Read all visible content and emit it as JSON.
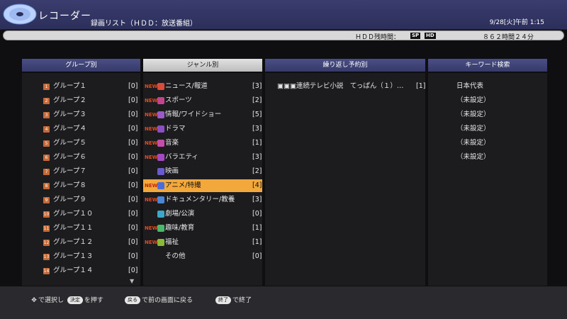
{
  "header": {
    "app_title": "レコーダー",
    "list_title": "録画リスト（ＨＤＤ：放送番組）",
    "datetime": "9/28[火]午前 1:15"
  },
  "hdd": {
    "label": "ＨＤＤ残時間：",
    "badge_sp": "SP",
    "badge_hd": "HD",
    "remaining": "８６２時間２４分"
  },
  "columns": {
    "group": "グループ別",
    "genre": "ジャンル別",
    "repeat": "繰り返し予約別",
    "keyword": "キーワード検索"
  },
  "groups": [
    {
      "badge": "1",
      "name": "グループ１",
      "count": "[0]"
    },
    {
      "badge": "2",
      "name": "グループ２",
      "count": "[0]"
    },
    {
      "badge": "3",
      "name": "グループ３",
      "count": "[0]"
    },
    {
      "badge": "4",
      "name": "グループ４",
      "count": "[0]"
    },
    {
      "badge": "5",
      "name": "グループ５",
      "count": "[0]"
    },
    {
      "badge": "6",
      "name": "グループ６",
      "count": "[0]"
    },
    {
      "badge": "7",
      "name": "グループ７",
      "count": "[0]"
    },
    {
      "badge": "8",
      "name": "グループ８",
      "count": "[0]"
    },
    {
      "badge": "9",
      "name": "グループ９",
      "count": "[0]"
    },
    {
      "badge": "10",
      "name": "グループ１０",
      "count": "[0]"
    },
    {
      "badge": "11",
      "name": "グループ１１",
      "count": "[0]"
    },
    {
      "badge": "12",
      "name": "グループ１２",
      "count": "[0]"
    },
    {
      "badge": "13",
      "name": "グループ１３",
      "count": "[0]"
    },
    {
      "badge": "14",
      "name": "グループ１４",
      "count": "[0]"
    }
  ],
  "genres": [
    {
      "new": "NEW",
      "name": "ニュース/報道",
      "count": "[3]",
      "color": "#d94b3b"
    },
    {
      "new": "NEW",
      "name": "スポーツ",
      "count": "[2]",
      "color": "#c2448e"
    },
    {
      "new": "NEW",
      "name": "情報/ワイドショー",
      "count": "[5]",
      "color": "#9b5ac8"
    },
    {
      "new": "NEW",
      "name": "ドラマ",
      "count": "[3]",
      "color": "#8a4fc0"
    },
    {
      "new": "NEW",
      "name": "音楽",
      "count": "[1]",
      "color": "#c34da8"
    },
    {
      "new": "NEW",
      "name": "バラエティ",
      "count": "[3]",
      "color": "#a448c4"
    },
    {
      "new": "",
      "name": "映画",
      "count": "[2]",
      "color": "#6a5ad0"
    },
    {
      "new": "NEW",
      "name": "アニメ/特撮",
      "count": "[4]",
      "color": "#4a6ed8"
    },
    {
      "new": "NEW",
      "name": "ドキュメンタリー/教養",
      "count": "[3]",
      "color": "#4a86d8"
    },
    {
      "new": "",
      "name": "劇場/公演",
      "count": "[0]",
      "color": "#3aa8c8"
    },
    {
      "new": "NEW",
      "name": "趣味/教育",
      "count": "[1]",
      "color": "#4ab86a"
    },
    {
      "new": "NEW",
      "name": "福祉",
      "count": "[1]",
      "color": "#8ab83a"
    },
    {
      "new": "",
      "name": "その他",
      "count": "[0]",
      "color": ""
    }
  ],
  "repeat_items": [
    {
      "name": "▣▣▣連続テレビ小説　てっぱん（１）…",
      "count": "[1]"
    }
  ],
  "keywords": [
    {
      "label": "日本代表"
    },
    {
      "label": "（未設定）"
    },
    {
      "label": "（未設定）"
    },
    {
      "label": "（未設定）"
    },
    {
      "label": "（未設定）"
    },
    {
      "label": "（未設定）"
    }
  ],
  "footer": {
    "select_text": "で選択し",
    "decide_key": "決定",
    "decide_text": "を押す",
    "back_key": "戻る",
    "back_text": "で前の画面に戻る",
    "end_key": "終了",
    "end_text": "で終了"
  }
}
